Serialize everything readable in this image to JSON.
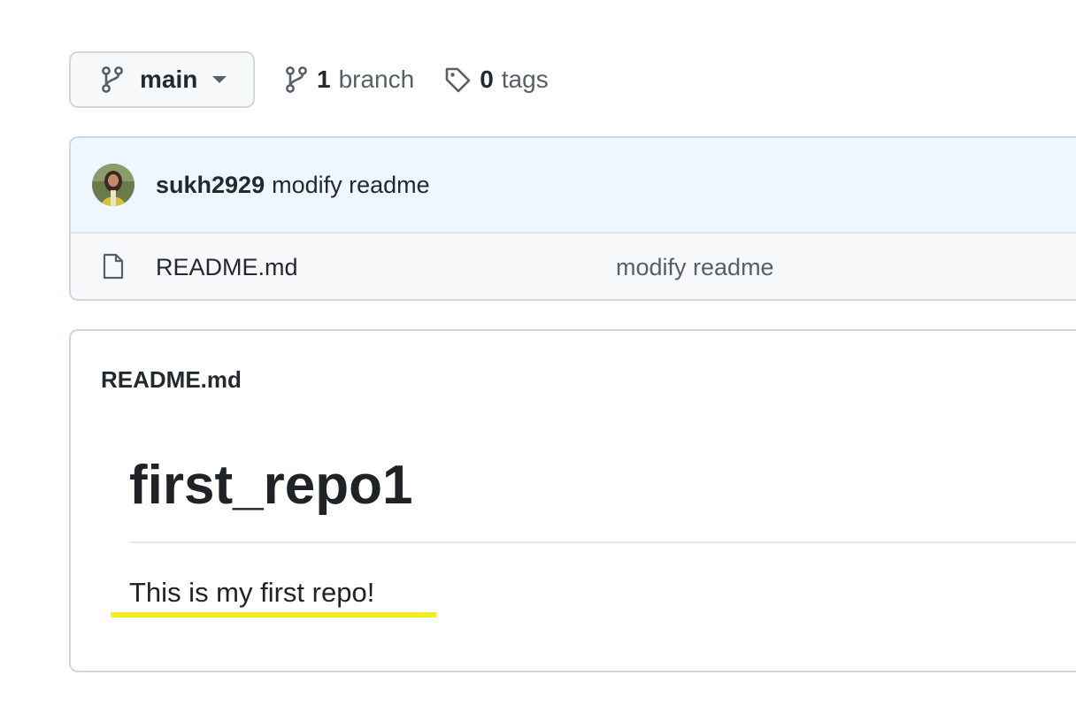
{
  "branch": {
    "current": "main",
    "icon": "git-branch-icon"
  },
  "branches": {
    "count": "1",
    "label": "branch"
  },
  "tags": {
    "count": "0",
    "label": "tags"
  },
  "latest_commit": {
    "author": "sukh2929",
    "message": "modify readme"
  },
  "files": [
    {
      "name": "README.md",
      "commit_message": "modify readme",
      "icon": "file-icon"
    }
  ],
  "readme": {
    "header": "README.md",
    "title": "first_repo1",
    "paragraph": "This is my first repo!",
    "highlight_color": "#f5ec23"
  }
}
